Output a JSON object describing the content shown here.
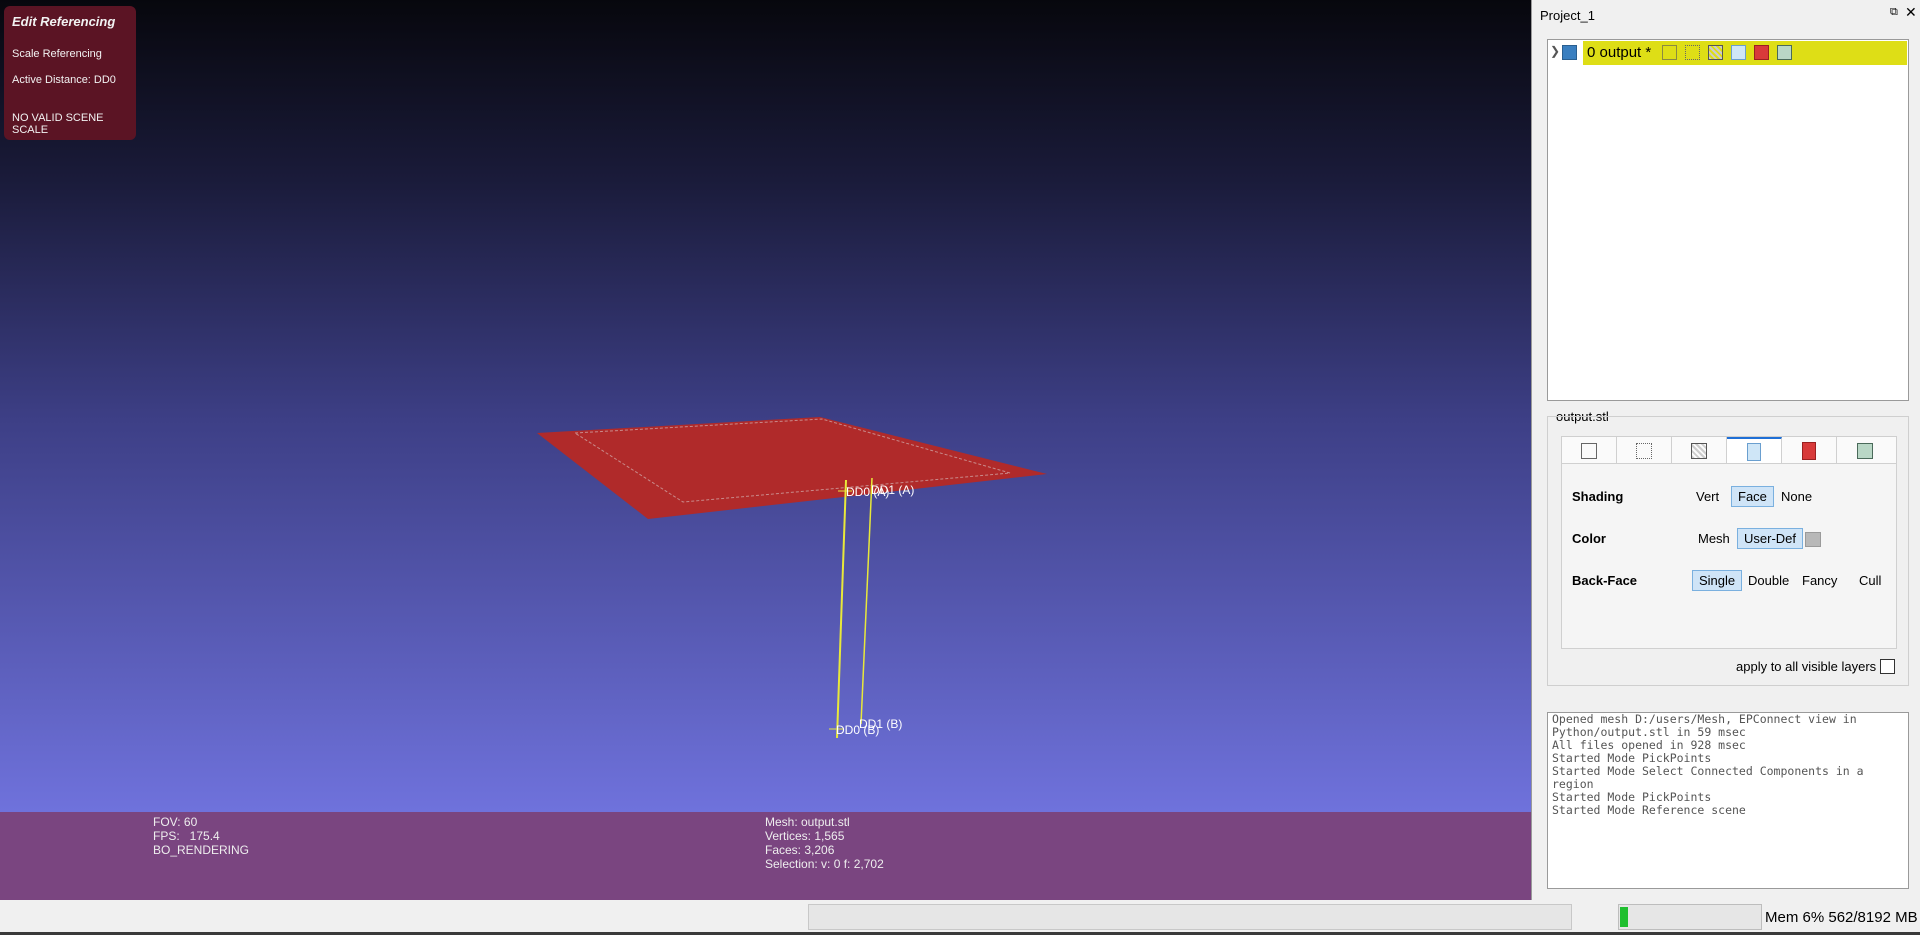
{
  "viewport": {
    "edit_panel": {
      "title": "Edit Referencing",
      "mode": "Scale Referencing",
      "active_distance": "Active Distance: DD0",
      "warning": "NO VALID SCENE SCALE"
    },
    "labels": {
      "dd0_a": "DD0 (A)",
      "dd1_a": "DD1 (A)",
      "dd0_b": "DD0 (B)",
      "dd1_b": "DD1 (B)"
    },
    "info": {
      "fov": "FOV: 60",
      "fps": "FPS:   175.4",
      "render_mode": "BO_RENDERING",
      "mesh": "Mesh: output.stl",
      "vertices": "Vertices: 1,565",
      "faces": "Faces: 3,206",
      "selection": "Selection: v: 0 f: 2,702"
    },
    "colors": {
      "mesh": "#b02a2a",
      "distance_lines": "#e8e83a",
      "info_bar": "#7a4580",
      "edit_panel": "#5b1424"
    }
  },
  "project": {
    "title": "Project_1",
    "layer": {
      "name": "0  output *",
      "highlight": "#dede16"
    },
    "layer_icons": [
      "eye-icon",
      "bbox-icon",
      "points-icon",
      "wire-icon",
      "flat-icon",
      "texture-icon",
      "selection-icon"
    ]
  },
  "render_settings": {
    "file": "output.stl",
    "tabs": [
      "bbox-tab-icon",
      "points-tab-icon",
      "wire-tab-icon",
      "fill-tab-icon",
      "texture-tab-icon",
      "selection-tab-icon"
    ],
    "active_tab_index": 3,
    "shading": {
      "label": "Shading",
      "options": [
        "Vert",
        "Face",
        "None"
      ],
      "selected": "Face"
    },
    "color": {
      "label": "Color",
      "options": [
        "Mesh",
        "User-Def"
      ],
      "selected": "User-Def"
    },
    "backface": {
      "label": "Back-Face",
      "options": [
        "Single",
        "Double",
        "Fancy",
        "Cull"
      ],
      "selected": "Single"
    },
    "apply_all": "apply to all visible layers"
  },
  "log": [
    "Opened mesh D:/users/Mesh, EPConnect view in Python/output.stl in 59 msec",
    "All files opened in 928 msec",
    "Started Mode PickPoints",
    "Started Mode Select Connected Components in a region",
    "Started Mode PickPoints",
    "Started Mode Reference scene"
  ],
  "status": {
    "memory": "Mem 6% 562/8192 MB",
    "memory_percent": 6
  }
}
